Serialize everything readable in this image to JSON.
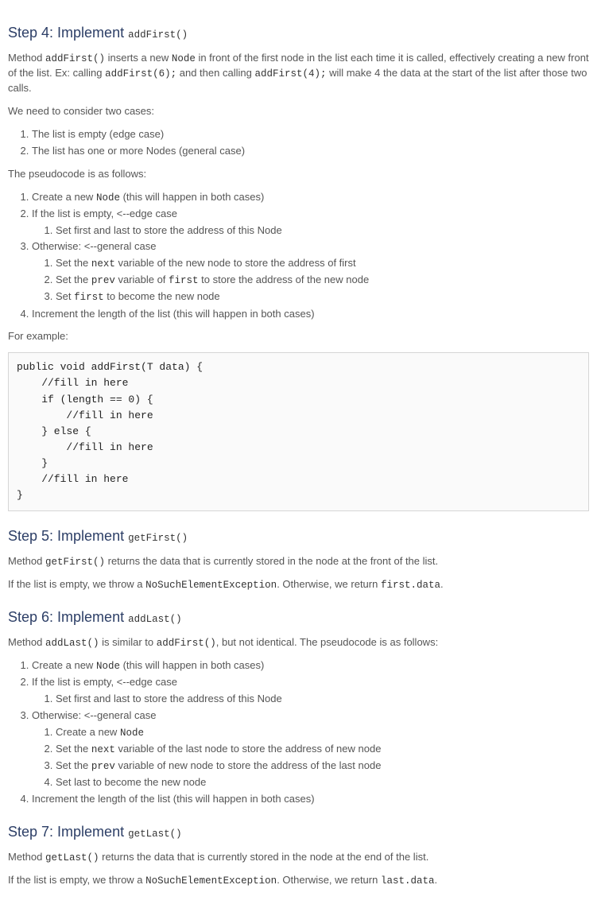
{
  "step4": {
    "heading_prefix": "Step 4: Implement ",
    "heading_code": "addFirst()",
    "intro_1a": "Method ",
    "intro_1b": "addFirst()",
    "intro_1c": " inserts a new ",
    "intro_1d": "Node",
    "intro_1e": " in front of the first node in the list each time it is called, effectively creating a new front of the list. Ex: calling ",
    "intro_1f": "addFirst(6);",
    "intro_1g": " and then calling ",
    "intro_1h": "addFirst(4);",
    "intro_1i": " will make 4 the data at the start of the list after those two calls.",
    "consider": "We need to consider two cases:",
    "case1": "The list is empty (edge case)",
    "case2": "The list has one or more Nodes (general case)",
    "pseudo_intro": "The pseudocode is as follows:",
    "ps1a": "Create a new ",
    "ps1b": "Node",
    "ps1c": " (this will happen in both cases)",
    "ps2": "If the list is empty, <--edge case",
    "ps2_1": "Set first and last to store the address of this Node",
    "ps3": "Otherwise: <--general case",
    "ps3_1a": "Set the ",
    "ps3_1b": "next",
    "ps3_1c": " variable of the new node to store the address of first",
    "ps3_2a": "Set the ",
    "ps3_2b": "prev",
    "ps3_2c": " variable of ",
    "ps3_2d": "first",
    "ps3_2e": " to store the address of the new node",
    "ps3_3a": "Set ",
    "ps3_3b": "first",
    "ps3_3c": " to become the new node",
    "ps4": "Increment the length of the list (this will happen in both cases)",
    "example_label": "For example:",
    "code": "public void addFirst(T data) {\n    //fill in here\n    if (length == 0) {\n        //fill in here\n    } else {\n        //fill in here\n    }\n    //fill in here\n}"
  },
  "step5": {
    "heading_prefix": "Step 5: Implement ",
    "heading_code": "getFirst()",
    "p1a": "Method ",
    "p1b": "getFirst()",
    "p1c": " returns the data that is currently stored in the node at the front of the list.",
    "p2a": "If the list is empty, we throw a ",
    "p2b": "NoSuchElementException",
    "p2c": ". Otherwise, we return ",
    "p2d": "first.data",
    "p2e": "."
  },
  "step6": {
    "heading_prefix": "Step 6: Implement ",
    "heading_code": "addLast()",
    "p1a": "Method ",
    "p1b": "addLast()",
    "p1c": " is similar to ",
    "p1d": "addFirst()",
    "p1e": ", but not identical. The pseudocode is as follows:",
    "ps1a": "Create a new ",
    "ps1b": "Node",
    "ps1c": " (this will happen in both cases)",
    "ps2": "If the list is empty, <--edge case",
    "ps2_1": "Set first and last to store the address of this Node",
    "ps3": "Otherwise: <--general case",
    "ps3_1a": "Create a new ",
    "ps3_1b": "Node",
    "ps3_2a": "Set the ",
    "ps3_2b": "next",
    "ps3_2c": " variable of the last node to store the address of new node",
    "ps3_3a": "Set the ",
    "ps3_3b": "prev",
    "ps3_3c": " variable of new node to store the address of the last node",
    "ps3_4": "Set last to become the new node",
    "ps4": "Increment the length of the list (this will happen in both cases)"
  },
  "step7": {
    "heading_prefix": "Step 7: Implement ",
    "heading_code": "getLast()",
    "p1a": "Method ",
    "p1b": "getLast()",
    "p1c": " returns the data that is currently stored in the node at the end of the list.",
    "p2a": "If the list is empty, we throw a ",
    "p2b": "NoSuchElementException",
    "p2c": ". Otherwise, we return ",
    "p2d": "last.data",
    "p2e": "."
  }
}
